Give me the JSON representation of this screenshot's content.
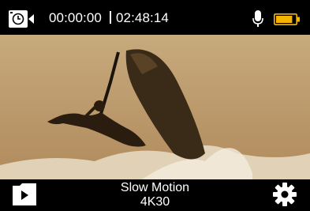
{
  "status": {
    "elapsed_time": "00:00:00",
    "separator": "I",
    "remaining_time": "02:48:14",
    "mic_icon": "microphone-icon",
    "battery_icon": "battery-icon",
    "battery_level": 0.85,
    "battery_color": "#f5b400"
  },
  "camera_icon": "video-camera-timer-icon",
  "viewfinder": {
    "subject": "jet-ski-rider-mid-air",
    "tint": "#c9ad83"
  },
  "bottom": {
    "gallery_icon": "gallery-play-icon",
    "mode_name": "Slow Motion",
    "mode_resolution": "4K30",
    "settings_icon": "gear-icon"
  }
}
